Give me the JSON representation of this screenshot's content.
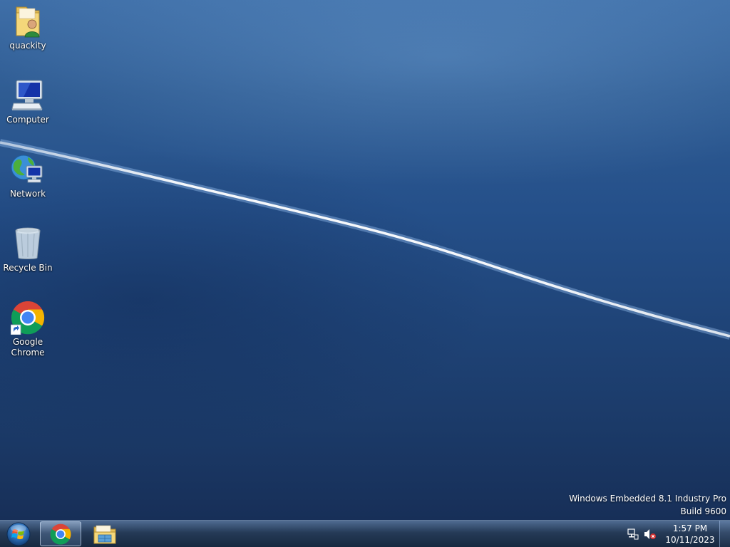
{
  "desktop": {
    "icons": [
      {
        "label": "quackity",
        "icon": "user-folder-icon"
      },
      {
        "label": "Computer",
        "icon": "computer-icon"
      },
      {
        "label": "Network",
        "icon": "network-icon"
      },
      {
        "label": "Recycle Bin",
        "icon": "recycle-bin-icon"
      },
      {
        "label": "Google Chrome",
        "icon": "chrome-shortcut-icon"
      }
    ],
    "watermark": {
      "line1": "Windows Embedded 8.1 Industry Pro",
      "line2": "Build 9600"
    }
  },
  "taskbar": {
    "start_icon": "windows-logo-icon",
    "pinned": [
      {
        "name": "Google Chrome",
        "icon": "chrome-icon",
        "active": true
      },
      {
        "name": "File Explorer",
        "icon": "file-explorer-icon",
        "active": false
      }
    ],
    "tray": {
      "icons": [
        "network-tray-icon",
        "volume-muted-icon"
      ],
      "time": "1:57 PM",
      "date": "10/11/2023"
    }
  },
  "colors": {
    "wallpaper_top": "#3f6fa8",
    "wallpaper_bottom": "#172f58",
    "taskbar": "#1e3452"
  }
}
